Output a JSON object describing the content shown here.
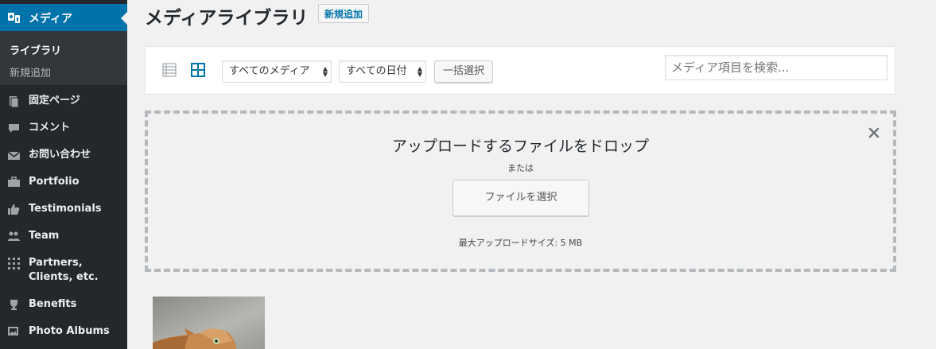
{
  "sidebar": {
    "media_label": "メディア",
    "submenu": [
      {
        "label": "ライブラリ"
      },
      {
        "label": "新規追加"
      }
    ],
    "items": [
      {
        "label": "固定ページ",
        "icon": "page-icon"
      },
      {
        "label": "コメント",
        "icon": "comment-icon"
      },
      {
        "label": "お問い合わせ",
        "icon": "mail-icon"
      },
      {
        "label": "Portfolio",
        "icon": "briefcase-icon"
      },
      {
        "label": "Testimonials",
        "icon": "thumbs-up-icon"
      },
      {
        "label": "Team",
        "icon": "people-icon"
      },
      {
        "label": "Partners, Clients, etc.",
        "icon": "grid-icon"
      },
      {
        "label": "Benefits",
        "icon": "trophy-icon"
      },
      {
        "label": "Photo Albums",
        "icon": "images-icon"
      }
    ]
  },
  "header": {
    "title": "メディアライブラリ",
    "add_new": "新規追加"
  },
  "toolbar": {
    "type_filter": "すべてのメディア",
    "date_filter": "すべての日付",
    "bulk_select": "一括選択",
    "search_placeholder": "メディア項目を検索..."
  },
  "uploader": {
    "title": "アップロードするファイルをドロップ",
    "or": "または",
    "select_files": "ファイルを選択",
    "max_size": "最大アップロードサイズ: 5 MB"
  },
  "colors": {
    "accent": "#0073aa",
    "sidebar": "#23282d",
    "submenu": "#32373c"
  }
}
